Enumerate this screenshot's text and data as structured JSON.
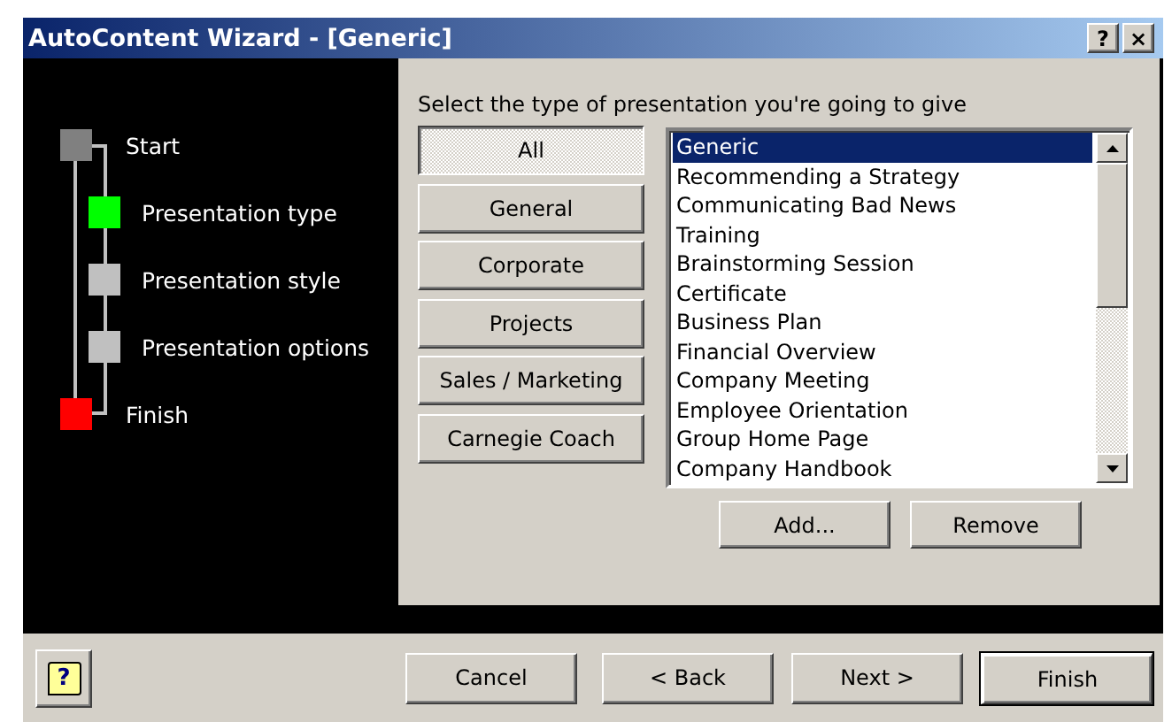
{
  "window": {
    "title": "AutoContent Wizard - [Generic]",
    "title_buttons": [
      "?",
      "×"
    ]
  },
  "steps": [
    {
      "label": "Start",
      "color": "#808080",
      "children": [
        {
          "label": "Presentation type",
          "color": "#00ff00"
        },
        {
          "label": "Presentation style",
          "color": "#c0c0c0"
        },
        {
          "label": "Presentation options",
          "color": "#c0c0c0"
        }
      ]
    },
    {
      "label": "Finish",
      "color": "#ff0000"
    }
  ],
  "prompt": "Select the type of presentation you're going to give",
  "categories": [
    {
      "label": "All",
      "selected": true
    },
    {
      "label": "General",
      "selected": false
    },
    {
      "label": "Corporate",
      "selected": false
    },
    {
      "label": "Projects",
      "selected": false
    },
    {
      "label": "Sales / Marketing",
      "selected": false
    },
    {
      "label": "Carnegie Coach",
      "selected": false
    }
  ],
  "presentations": [
    {
      "label": "Generic",
      "selected": true
    },
    {
      "label": "Recommending a Strategy",
      "selected": false
    },
    {
      "label": "Communicating Bad News",
      "selected": false
    },
    {
      "label": "Training",
      "selected": false
    },
    {
      "label": "Brainstorming Session",
      "selected": false
    },
    {
      "label": "Certificate",
      "selected": false
    },
    {
      "label": "Business Plan",
      "selected": false
    },
    {
      "label": "Financial Overview",
      "selected": false
    },
    {
      "label": "Company Meeting",
      "selected": false
    },
    {
      "label": "Employee Orientation",
      "selected": false
    },
    {
      "label": "Group Home Page",
      "selected": false
    },
    {
      "label": "Company Handbook",
      "selected": false
    }
  ],
  "list_buttons": [
    "Add...",
    "Remove"
  ],
  "help_button": {
    "label": "?"
  },
  "footer_buttons": [
    {
      "label": "Cancel",
      "default": false
    },
    {
      "label": "< Back",
      "default": false
    },
    {
      "label": "Next >",
      "default": false
    },
    {
      "label": "Finish",
      "default": true
    }
  ]
}
